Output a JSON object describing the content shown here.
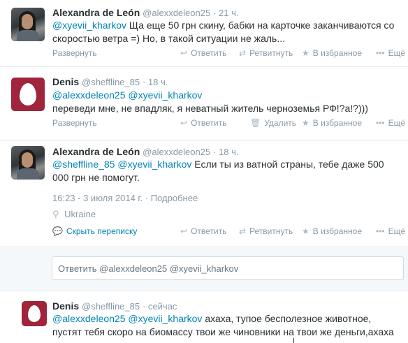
{
  "tweets": [
    {
      "fullname": "Alexandra de León",
      "username": "@alexxdeleon25",
      "time": "· 21 ч.",
      "mention1": "@xyevii_kharkov",
      "text_line1": " Ща еще 50 грн скину, бабки на карточке заканчиваются со",
      "text_line2": "скоростью ветра =) Но, в такой ситуации не жаль...",
      "expand": "Развернуть",
      "actions": {
        "reply": "Ответить",
        "retweet": "Ретвитнуть",
        "favorite": "В избранное",
        "more": "Ещё"
      }
    },
    {
      "fullname": "Denis",
      "username": "@sheffline_85",
      "time": "· 18 ч.",
      "mention1": "@alexxdeleon25",
      "mention2": "@xyevii_kharkov",
      "text_line2": "переведи мне, не впадляк, я неватный житель черноземья РФ!?а!?)))",
      "expand": "Развернуть",
      "actions": {
        "reply": "Ответить",
        "delete": "Удалить",
        "favorite": "В избранное",
        "more": "Ещё"
      }
    },
    {
      "fullname": "Alexandra de León",
      "username": "@alexxdeleon25",
      "time": "· 18 ч.",
      "mention1": "@sheffline_85",
      "mention2": "@xyevii_kharkov",
      "text_line1": " Если ты из ватной страны, тебе даже 500",
      "text_line2": "000 грн не помогут.",
      "datetime": "16:23 - 3 июля 2014 г.",
      "details": "· Подробнее",
      "location": "Ukraine",
      "hide": "Скрыть переписку",
      "actions": {
        "reply": "Ответить",
        "retweet": "Ретвитнуть",
        "favorite": "В избранное",
        "more": "Ещё"
      }
    },
    {
      "fullname": "Denis",
      "username": "@sheffline_85",
      "time": "· сейчас",
      "mention1": "@alexxdeleon25",
      "mention2": "@xyevii_kharkov",
      "text_line1": " ахаха, тупое бесполезное животное,",
      "text_line2": "пустят тебя скоро на биомассу твои же чиновники на твои же деньги,ахаха"
    }
  ],
  "reply_box": {
    "placeholder": "Ответить @alexxdeleon25 @xyevii_kharkov"
  },
  "icons": {
    "reply": "reply-icon",
    "retweet": "retweet-icon",
    "favorite": "star-icon",
    "more": "more-icon",
    "delete": "trash-icon",
    "location": "location-pin-icon",
    "conversation": "conversation-icon"
  },
  "colors": {
    "link": "#0084b4",
    "meta": "#8899a6",
    "egg_bg": "#a0243b"
  }
}
